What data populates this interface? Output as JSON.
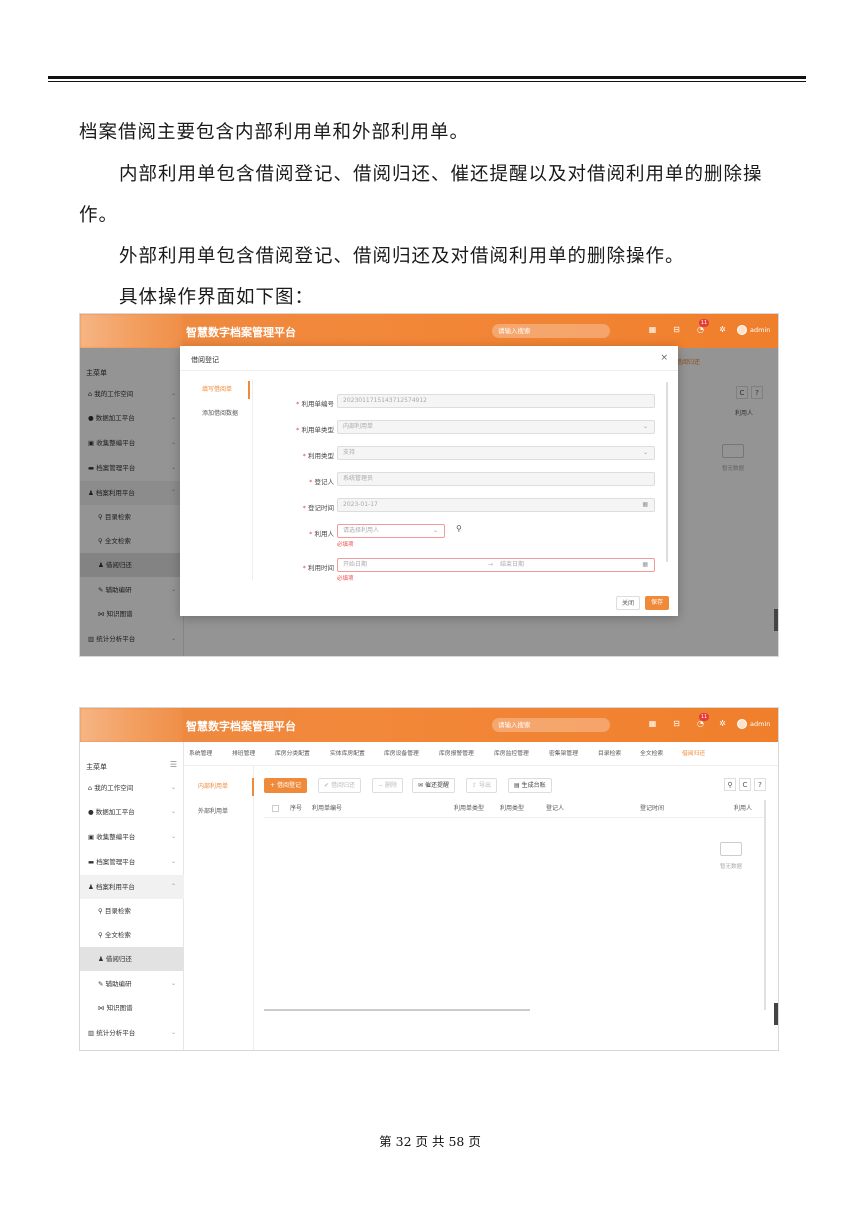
{
  "paragraphs": {
    "p1": "档案借阅主要包含内部利用单和外部利用单。",
    "p2_line1": "内部利用单包含借阅登记、借阅归还、催还提醒以及对借阅利用单的删除操",
    "p2_line2": "作。",
    "p3": "外部利用单包含借阅登记、借阅归还及对借阅利用单的删除操作。",
    "p4": "具体操作界面如下图："
  },
  "app": {
    "title": "智慧数字档案管理平台",
    "search_placeholder": "请输入搜索",
    "badge_count": "11",
    "user": "admin"
  },
  "sidebar": {
    "header": "主菜单",
    "items": [
      {
        "label": "我的工作空间",
        "icon": "home-icon"
      },
      {
        "label": "数据加工平台",
        "icon": "gear-icon"
      },
      {
        "label": "收集整编平台",
        "icon": "folder-icon"
      },
      {
        "label": "档案管理平台",
        "icon": "archive-icon"
      },
      {
        "label": "档案利用平台",
        "icon": "user-icon"
      },
      {
        "label": "目录检索",
        "icon": "search-icon"
      },
      {
        "label": "全文检索",
        "icon": "search-icon"
      },
      {
        "label": "借阅归还",
        "icon": "user-icon"
      },
      {
        "label": "辅助编研",
        "icon": "edit-icon"
      },
      {
        "label": "知识图谱",
        "icon": "graph-icon"
      },
      {
        "label": "统计分析平台",
        "icon": "chart-icon"
      }
    ]
  },
  "dialog": {
    "title": "借阅登记",
    "close": "×",
    "tabs": [
      "填写借阅单",
      "添加借阅数据"
    ],
    "fields": [
      {
        "label": "利用单编号",
        "value": "2023011715143712574912"
      },
      {
        "label": "利用单类型",
        "value": "内部利用单"
      },
      {
        "label": "利用类型",
        "value": "支持"
      },
      {
        "label": "登记人",
        "value": "系统管理员"
      },
      {
        "label": "登记时间",
        "value": "2023-01-17"
      },
      {
        "label": "利用人",
        "value": "请选择利用人"
      },
      {
        "label": "利用时间",
        "value": "开始日期",
        "value_end": "结束日期",
        "sep": "→"
      }
    ],
    "required_msg": "必填项",
    "cancel_label": "关闭",
    "save_label": "保存"
  },
  "bg_page": {
    "tab_active": "借阅归还",
    "col_user": "利用人",
    "empty": "暂无数据"
  },
  "nav_tabs": [
    "系统管理",
    "排班管理",
    "库房分类配置",
    "实体库房配置",
    "库房设备管理",
    "库房报警管理",
    "库房监控管理",
    "密集架管理",
    "目录检索",
    "全文检索",
    "借阅归还"
  ],
  "inner_tabs": [
    "内部利用单",
    "外部利用单"
  ],
  "toolbar": {
    "register": "借阅登记",
    "return": "借阅归还",
    "delete": "删除",
    "remind": "催还提醒",
    "export": "导出",
    "generate": "生成台账"
  },
  "table": {
    "columns": [
      "序号",
      "利用单编号",
      "利用单类型",
      "利用类型",
      "登记人",
      "登记时间",
      "利用人"
    ],
    "empty": "暂无数据"
  },
  "footer": "第 32 页 共 58 页",
  "colors": {
    "brand": "#f08a3b",
    "error": "#e44444"
  }
}
